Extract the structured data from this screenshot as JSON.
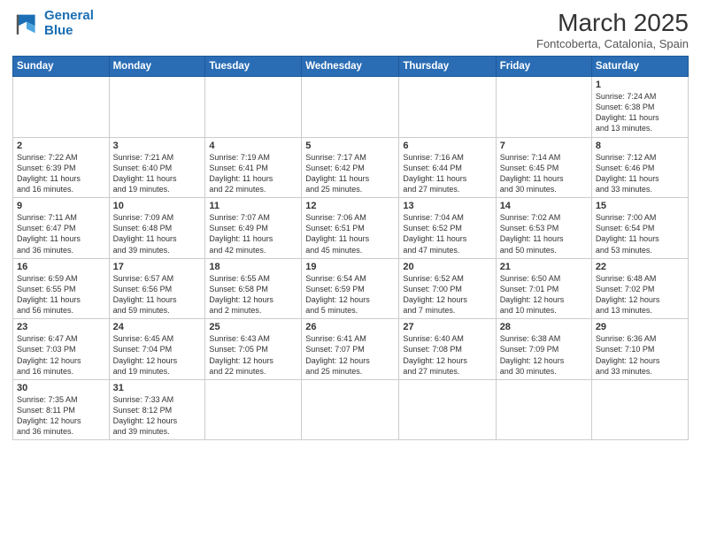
{
  "logo": {
    "line1": "General",
    "line2": "Blue"
  },
  "title": "March 2025",
  "location": "Fontcoberta, Catalonia, Spain",
  "days_of_week": [
    "Sunday",
    "Monday",
    "Tuesday",
    "Wednesday",
    "Thursday",
    "Friday",
    "Saturday"
  ],
  "weeks": [
    [
      {
        "num": "",
        "info": ""
      },
      {
        "num": "",
        "info": ""
      },
      {
        "num": "",
        "info": ""
      },
      {
        "num": "",
        "info": ""
      },
      {
        "num": "",
        "info": ""
      },
      {
        "num": "",
        "info": ""
      },
      {
        "num": "1",
        "info": "Sunrise: 7:24 AM\nSunset: 6:38 PM\nDaylight: 11 hours\nand 13 minutes."
      }
    ],
    [
      {
        "num": "2",
        "info": "Sunrise: 7:22 AM\nSunset: 6:39 PM\nDaylight: 11 hours\nand 16 minutes."
      },
      {
        "num": "3",
        "info": "Sunrise: 7:21 AM\nSunset: 6:40 PM\nDaylight: 11 hours\nand 19 minutes."
      },
      {
        "num": "4",
        "info": "Sunrise: 7:19 AM\nSunset: 6:41 PM\nDaylight: 11 hours\nand 22 minutes."
      },
      {
        "num": "5",
        "info": "Sunrise: 7:17 AM\nSunset: 6:42 PM\nDaylight: 11 hours\nand 25 minutes."
      },
      {
        "num": "6",
        "info": "Sunrise: 7:16 AM\nSunset: 6:44 PM\nDaylight: 11 hours\nand 27 minutes."
      },
      {
        "num": "7",
        "info": "Sunrise: 7:14 AM\nSunset: 6:45 PM\nDaylight: 11 hours\nand 30 minutes."
      },
      {
        "num": "8",
        "info": "Sunrise: 7:12 AM\nSunset: 6:46 PM\nDaylight: 11 hours\nand 33 minutes."
      }
    ],
    [
      {
        "num": "9",
        "info": "Sunrise: 7:11 AM\nSunset: 6:47 PM\nDaylight: 11 hours\nand 36 minutes."
      },
      {
        "num": "10",
        "info": "Sunrise: 7:09 AM\nSunset: 6:48 PM\nDaylight: 11 hours\nand 39 minutes."
      },
      {
        "num": "11",
        "info": "Sunrise: 7:07 AM\nSunset: 6:49 PM\nDaylight: 11 hours\nand 42 minutes."
      },
      {
        "num": "12",
        "info": "Sunrise: 7:06 AM\nSunset: 6:51 PM\nDaylight: 11 hours\nand 45 minutes."
      },
      {
        "num": "13",
        "info": "Sunrise: 7:04 AM\nSunset: 6:52 PM\nDaylight: 11 hours\nand 47 minutes."
      },
      {
        "num": "14",
        "info": "Sunrise: 7:02 AM\nSunset: 6:53 PM\nDaylight: 11 hours\nand 50 minutes."
      },
      {
        "num": "15",
        "info": "Sunrise: 7:00 AM\nSunset: 6:54 PM\nDaylight: 11 hours\nand 53 minutes."
      }
    ],
    [
      {
        "num": "16",
        "info": "Sunrise: 6:59 AM\nSunset: 6:55 PM\nDaylight: 11 hours\nand 56 minutes."
      },
      {
        "num": "17",
        "info": "Sunrise: 6:57 AM\nSunset: 6:56 PM\nDaylight: 11 hours\nand 59 minutes."
      },
      {
        "num": "18",
        "info": "Sunrise: 6:55 AM\nSunset: 6:58 PM\nDaylight: 12 hours\nand 2 minutes."
      },
      {
        "num": "19",
        "info": "Sunrise: 6:54 AM\nSunset: 6:59 PM\nDaylight: 12 hours\nand 5 minutes."
      },
      {
        "num": "20",
        "info": "Sunrise: 6:52 AM\nSunset: 7:00 PM\nDaylight: 12 hours\nand 7 minutes."
      },
      {
        "num": "21",
        "info": "Sunrise: 6:50 AM\nSunset: 7:01 PM\nDaylight: 12 hours\nand 10 minutes."
      },
      {
        "num": "22",
        "info": "Sunrise: 6:48 AM\nSunset: 7:02 PM\nDaylight: 12 hours\nand 13 minutes."
      }
    ],
    [
      {
        "num": "23",
        "info": "Sunrise: 6:47 AM\nSunset: 7:03 PM\nDaylight: 12 hours\nand 16 minutes."
      },
      {
        "num": "24",
        "info": "Sunrise: 6:45 AM\nSunset: 7:04 PM\nDaylight: 12 hours\nand 19 minutes."
      },
      {
        "num": "25",
        "info": "Sunrise: 6:43 AM\nSunset: 7:05 PM\nDaylight: 12 hours\nand 22 minutes."
      },
      {
        "num": "26",
        "info": "Sunrise: 6:41 AM\nSunset: 7:07 PM\nDaylight: 12 hours\nand 25 minutes."
      },
      {
        "num": "27",
        "info": "Sunrise: 6:40 AM\nSunset: 7:08 PM\nDaylight: 12 hours\nand 27 minutes."
      },
      {
        "num": "28",
        "info": "Sunrise: 6:38 AM\nSunset: 7:09 PM\nDaylight: 12 hours\nand 30 minutes."
      },
      {
        "num": "29",
        "info": "Sunrise: 6:36 AM\nSunset: 7:10 PM\nDaylight: 12 hours\nand 33 minutes."
      }
    ],
    [
      {
        "num": "30",
        "info": "Sunrise: 7:35 AM\nSunset: 8:11 PM\nDaylight: 12 hours\nand 36 minutes."
      },
      {
        "num": "31",
        "info": "Sunrise: 7:33 AM\nSunset: 8:12 PM\nDaylight: 12 hours\nand 39 minutes."
      },
      {
        "num": "",
        "info": ""
      },
      {
        "num": "",
        "info": ""
      },
      {
        "num": "",
        "info": ""
      },
      {
        "num": "",
        "info": ""
      },
      {
        "num": "",
        "info": ""
      }
    ]
  ]
}
